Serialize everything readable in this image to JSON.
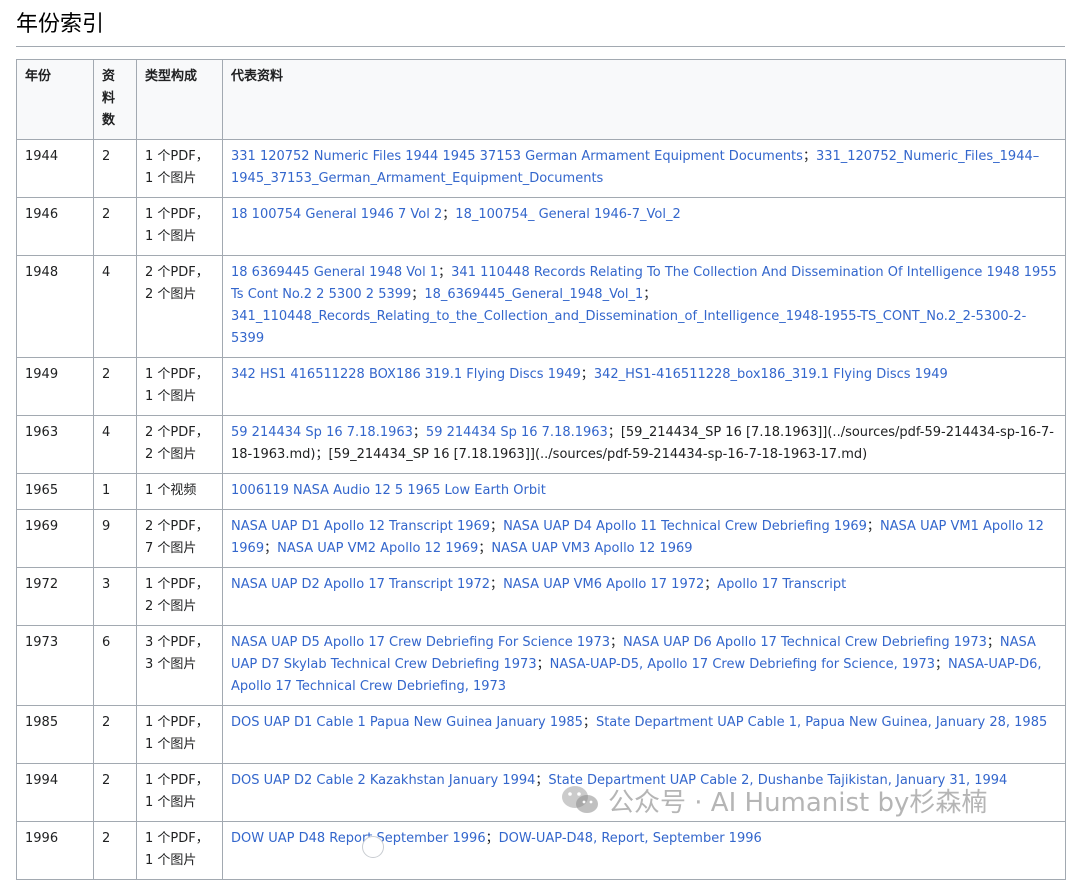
{
  "heading": "年份索引",
  "headers": [
    "年份",
    "资\n料\n数",
    "类型构成",
    "代表资料"
  ],
  "rows": [
    {
      "year": "1944",
      "count": "2",
      "composition": "1 个PDF，\n1 个图片",
      "items": [
        {
          "text": "331 120752 Numeric Files 1944 1945 37153 German Armament Equipment Documents",
          "link": true
        },
        {
          "text": "331_120752_Numeric_Files_1944–1945_37153_German_Armament_Equipment_Documents",
          "link": true
        }
      ]
    },
    {
      "year": "1946",
      "count": "2",
      "composition": "1 个PDF，\n1 个图片",
      "items": [
        {
          "text": "18 100754 General 1946 7 Vol 2",
          "link": true
        },
        {
          "text": "18_100754_ General 1946-7_Vol_2",
          "link": true
        }
      ]
    },
    {
      "year": "1948",
      "count": "4",
      "composition": "2 个PDF，\n2 个图片",
      "items": [
        {
          "text": "18 6369445 General 1948 Vol 1",
          "link": true
        },
        {
          "text": "341 110448 Records Relating To The Collection And Dissemination Of Intelligence 1948 1955 Ts Cont No.2 2 5300 2 5399",
          "link": true
        },
        {
          "text": "18_6369445_General_1948_Vol_1",
          "link": true
        },
        {
          "text": "341_110448_Records_Relating_to_the_Collection_and_Dissemination_of_Intelligence_1948-1955-TS_CONT_No.2_2-5300-2-5399",
          "link": true
        }
      ]
    },
    {
      "year": "1949",
      "count": "2",
      "composition": "1 个PDF，\n1 个图片",
      "items": [
        {
          "text": "342 HS1 416511228 BOX186 319.1 Flying Discs 1949",
          "link": true
        },
        {
          "text": "342_HS1-416511228_box186_319.1 Flying Discs 1949",
          "link": true
        }
      ]
    },
    {
      "year": "1963",
      "count": "4",
      "composition": "2 个PDF，\n2 个图片",
      "items": [
        {
          "text": "59 214434 Sp 16 7.18.1963",
          "link": true
        },
        {
          "text": "59 214434 Sp 16 7.18.1963",
          "link": true
        },
        {
          "text": "[59_214434_SP 16 [7.18.1963]](../sources/pdf-59-214434-sp-16-7-18-1963.md)",
          "link": false
        },
        {
          "text": "[59_214434_SP 16 [7.18.1963]](../sources/pdf-59-214434-sp-16-7-18-1963-17.md)",
          "link": false
        }
      ]
    },
    {
      "year": "1965",
      "count": "1",
      "composition": "1 个视频",
      "items": [
        {
          "text": "1006119 NASA Audio 12 5 1965 Low Earth Orbit",
          "link": true
        }
      ]
    },
    {
      "year": "1969",
      "count": "9",
      "composition": "2 个PDF，\n7 个图片",
      "items": [
        {
          "text": "NASA UAP D1 Apollo 12 Transcript 1969",
          "link": true
        },
        {
          "text": "NASA UAP D4 Apollo 11 Technical Crew Debriefing 1969",
          "link": true
        },
        {
          "text": "NASA UAP VM1 Apollo 12 1969",
          "link": true
        },
        {
          "text": "NASA UAP VM2 Apollo 12 1969",
          "link": true
        },
        {
          "text": "NASA UAP VM3 Apollo 12 1969",
          "link": true
        }
      ]
    },
    {
      "year": "1972",
      "count": "3",
      "composition": "1 个PDF，\n2 个图片",
      "items": [
        {
          "text": "NASA UAP D2 Apollo 17 Transcript 1972",
          "link": true
        },
        {
          "text": "NASA UAP VM6 Apollo 17 1972",
          "link": true
        },
        {
          "text": "Apollo 17 Transcript",
          "link": true
        }
      ]
    },
    {
      "year": "1973",
      "count": "6",
      "composition": "3 个PDF，\n3 个图片",
      "items": [
        {
          "text": "NASA UAP D5 Apollo 17 Crew Debriefing For Science 1973",
          "link": true
        },
        {
          "text": "NASA UAP D6 Apollo 17 Technical Crew Debriefing 1973",
          "link": true
        },
        {
          "text": "NASA UAP D7 Skylab Technical Crew Debriefing 1973",
          "link": true
        },
        {
          "text": "NASA-UAP-D5, Apollo 17 Crew Debriefing for Science, 1973",
          "link": true
        },
        {
          "text": "NASA-UAP-D6, Apollo 17 Technical Crew Debriefing, 1973",
          "link": true
        }
      ]
    },
    {
      "year": "1985",
      "count": "2",
      "composition": "1 个PDF，\n1 个图片",
      "items": [
        {
          "text": "DOS UAP D1 Cable 1 Papua New Guinea January 1985",
          "link": true
        },
        {
          "text": "State Department UAP Cable 1, Papua New Guinea, January 28, 1985",
          "link": true
        }
      ]
    },
    {
      "year": "1994",
      "count": "2",
      "composition": "1 个PDF，\n1 个图片",
      "items": [
        {
          "text": "DOS UAP D2 Cable 2 Kazakhstan January 1994",
          "link": true
        },
        {
          "text": "State Department UAP Cable 2, Dushanbe Tajikistan, January 31, 1994",
          "link": true
        }
      ]
    },
    {
      "year": "1996",
      "count": "2",
      "composition": "1 个PDF，\n1 个图片",
      "items": [
        {
          "text": "DOW UAP D48 Report September 1996",
          "link": true
        },
        {
          "text": "DOW-UAP-D48, Report, September 1996",
          "link": true
        }
      ]
    }
  ],
  "separator": "；",
  "watermark": "公众号 · AI Humanist by杉森楠",
  "colors": {
    "link": "#3366cc",
    "border": "#a2a9b1",
    "header_bg": "#f8f9fa"
  }
}
